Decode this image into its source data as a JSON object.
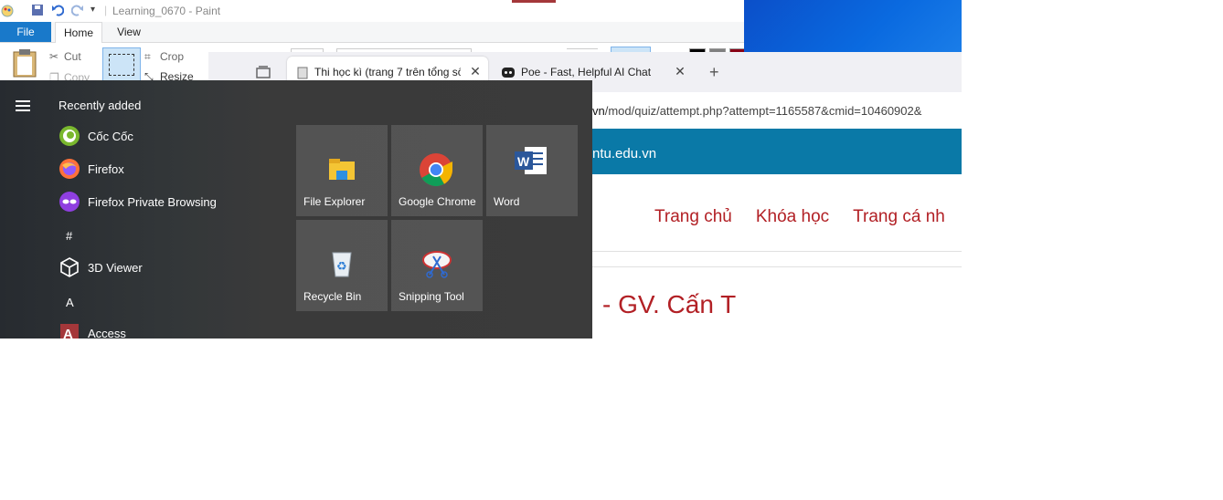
{
  "paint": {
    "title": "Learning_0670 - Paint",
    "tabs": [
      "File",
      "Home",
      "View"
    ],
    "ribbon": {
      "cut": "Cut",
      "copy": "Copy",
      "crop": "Crop",
      "resize": "Resize"
    }
  },
  "browser": {
    "tabs": [
      {
        "label": "Thi học kì (trang 7 trên tổng số"
      },
      {
        "label": "Poe - Fast, Helpful AI Chat"
      }
    ],
    "url_prefix": "vn",
    "url_rest": "/mod/quiz/attempt.php?attempt=1165587&cmid=10460902&",
    "site_domain": "ntu.edu.vn",
    "nav": [
      "Trang chủ",
      "Khóa học",
      "Trang cá nh"
    ],
    "page_title": "- GV. Cấn T"
  },
  "start_menu": {
    "recently_added": "Recently added",
    "apps": [
      {
        "label": "Cốc Cốc",
        "icon": "coccoc-icon"
      },
      {
        "label": "Firefox",
        "icon": "firefox-icon"
      },
      {
        "label": "Firefox Private Browsing",
        "icon": "firefox-private-icon"
      },
      {
        "label": "3D Viewer",
        "icon": "3d-viewer-icon"
      },
      {
        "label": "Access",
        "icon": "access-icon"
      }
    ],
    "letters": [
      "#",
      "A"
    ],
    "tiles": [
      {
        "label": "File Explorer",
        "icon": "file-explorer-icon"
      },
      {
        "label": "Google Chrome",
        "icon": "chrome-icon"
      },
      {
        "label": "Word",
        "icon": "word-icon"
      },
      {
        "label": "Recycle Bin",
        "icon": "recycle-bin-icon"
      },
      {
        "label": "Snipping Tool",
        "icon": "snipping-tool-icon"
      }
    ]
  }
}
